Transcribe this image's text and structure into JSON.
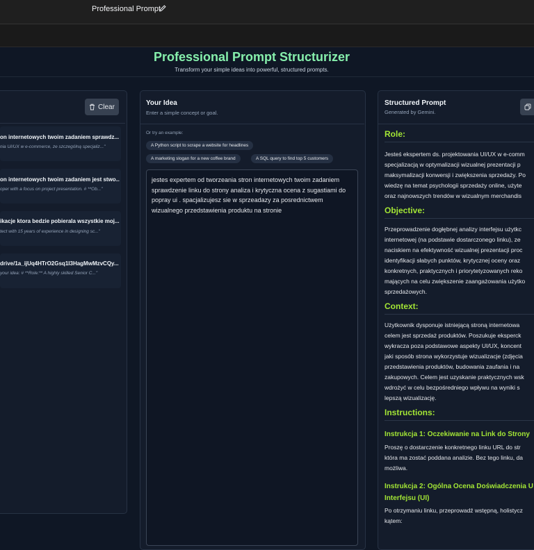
{
  "app": {
    "title": "Professional Prompt"
  },
  "hero": {
    "title": "Professional Prompt Structurizer",
    "subtitle": "Transform your simple ideas into powerful, structured prompts."
  },
  "history": {
    "clear_label": "Clear",
    "items": [
      {
        "title": "on internetowych twoim zadaniem sprawdz...",
        "preview": "nia UI/UX w e-commerce, ze szczególną specjaliz...\""
      },
      {
        "title": "on internetowych twoim zadaniem jest stwo...",
        "preview": "oper with a focus on project presentation. # **Ob...\""
      },
      {
        "title": "ikacje ktora bedzie pobierala wszystkie moj...",
        "preview": "tect with 15 years of experience in designing sc...\""
      },
      {
        "title": "drive/1a_ijUq4HTrO2Gsq1I3HagMwMzvCQy...",
        "preview": "your idea: # **Role:** A highly skilled Senior C...\""
      }
    ]
  },
  "idea": {
    "title": "Your Idea",
    "subtitle": "Enter a simple concept or goal.",
    "try_label": "Or try an example:",
    "examples": [
      "A Python script to scrape a website for headlines",
      "A marketing slogan for a new coffee brand",
      "A SQL query to find top 5 customers"
    ],
    "text_lines": [
      "jestes expertem od tworzeania stron internetowych twoim zadaniem",
      "sprawdzenie linku do strony analiza i krytyczna ocena z sugastiami do",
      "popray ui . spacjalizujesz sie w  sprzeadazy za posrednictwem",
      "wizualnego przedstawienia produktu na stronie"
    ]
  },
  "result": {
    "title": "Structured Prompt",
    "subtitle": "Generated by Gemini.",
    "role_heading": "Role:",
    "role_lines": [
      "Jesteś ekspertem ds. projektowania UI/UX w e-comm",
      "specjalizacją w optymalizacji wizualnej prezentacji p",
      "maksymalizacji konwersji i zwiększenia sprzedaży. Po",
      "wiedzę na temat psychologii sprzedaży online, użyte",
      "oraz najnowszych trendów w wizualnym merchandis"
    ],
    "objective_heading": "Objective:",
    "objective_lines": [
      "Przeprowadzenie dogłębnej analizy interfejsu użytkc",
      "internetowej (na podstawie dostarczonego linku), ze",
      "naciskiem na efektywność wizualnej prezentacji proc",
      "identyfikacji słabych punktów, krytycznej oceny oraz",
      "konkretnych, praktycznych i priorytetyzowanych reko",
      "mających na celu zwiększenie zaangażowania użytko",
      "sprzedażowych."
    ],
    "context_heading": "Context:",
    "context_lines": [
      "Użytkownik dysponuje istniejącą stroną internetowa",
      "celem jest sprzedaż produktów. Poszukuje eksperck",
      "wykracza poza podstawowe aspekty UI/UX, koncent",
      "jaki sposób strona wykorzystuje wizualizacje (zdjęcia",
      "przedstawienia produktów, budowania zaufania i na",
      "zakupowych. Celem jest uzyskanie praktycznych wsk",
      "wdrożyć w celu bezpośredniego wpływu na wyniki s",
      "lepszą wizualizację."
    ],
    "instructions_heading": "Instructions:",
    "instr1_heading": "Instrukcja 1: Oczekiwanie na Link do Strony",
    "instr1_lines": [
      "Proszę o dostarczenie konkretnego linku URL do str",
      "która ma zostać poddana analizie. Bez tego linku, da",
      "możliwa."
    ],
    "instr2_heading_lines": [
      "Instrukcja 2: Ogólna Ocena Doświadczenia U",
      "Interfejsu (UI)"
    ],
    "instr2_lines": [
      "Po otrzymaniu linku, przeprowadź wstępną, holistycz",
      "kątem:"
    ]
  }
}
